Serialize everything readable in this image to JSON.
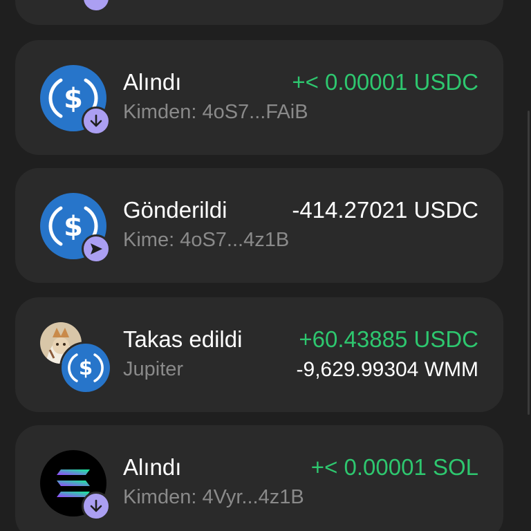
{
  "transactions": [
    {
      "title": "Alındı",
      "subtitle": "Kimden: 4oS7...FAiB",
      "amount": "+< 0.00001 USDC",
      "token_icon": "usdc-icon",
      "badge_icon": "arrow-down-icon",
      "amount_color": "#2ec76f"
    },
    {
      "title": "Gönderildi",
      "subtitle": "Kime: 4oS7...4z1B",
      "amount": "-414.27021 USDC",
      "token_icon": "usdc-icon",
      "badge_icon": "send-icon",
      "amount_color": "#ffffff"
    },
    {
      "title": "Takas edildi",
      "subtitle": "Jupiter",
      "amount": "+60.43885 USDC",
      "amount_secondary": "-9,629.99304 WMM",
      "token_icon": "usdc-icon",
      "avatar_icon": "token-avatar",
      "amount_color": "#2ec76f"
    },
    {
      "title": "Alındı",
      "subtitle": "Kimden: 4Vyr...4z1B",
      "amount": "+< 0.00001 SOL",
      "token_icon": "solana-icon",
      "badge_icon": "arrow-down-icon",
      "amount_color": "#2ec76f"
    }
  ],
  "colors": {
    "background": "#1f1f1f",
    "card": "#2a2a2a",
    "usdc_blue": "#2775ca",
    "badge_purple": "#ab9ff2",
    "positive": "#2ec76f"
  }
}
